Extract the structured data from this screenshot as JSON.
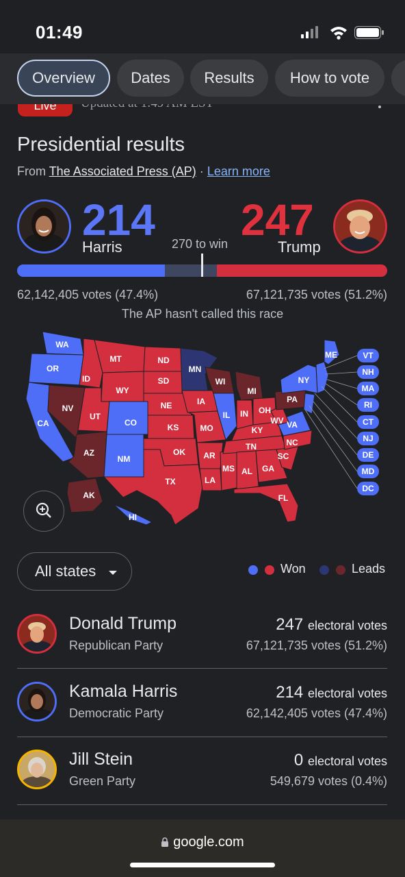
{
  "status": {
    "time": "01:49"
  },
  "tabs": [
    {
      "label": "Overview",
      "active": true
    },
    {
      "label": "Dates"
    },
    {
      "label": "Results"
    },
    {
      "label": "How to vote"
    }
  ],
  "live": {
    "badge": "Live",
    "updated": "Updated at 1:49 AM EST"
  },
  "header": {
    "title": "Presidential results",
    "source_prefix": "From",
    "source_name": "The Associated Press (AP)",
    "separator": "·",
    "learn_more": "Learn more"
  },
  "scoreboard": {
    "harris_ev": "214",
    "harris_name": "Harris",
    "trump_ev": "247",
    "trump_name": "Trump",
    "to_win": "270 to win",
    "harris_votes": "62,142,405 votes (47.4%)",
    "trump_votes": "67,121,735 votes (51.2%)",
    "harris_won_fraction": 0.4,
    "harris_lead_fraction": 0.14,
    "trump_fraction": 0.46,
    "called": "The AP hasn't called this race"
  },
  "colors": {
    "dem_won": "#4f6ef7",
    "dem_lead": "#2d3573",
    "rep_won": "#d32f3e",
    "rep_lead": "#6b262b",
    "background": "#202124"
  },
  "map": {
    "states": [
      "WA",
      "OR",
      "CA",
      "NV",
      "ID",
      "MT",
      "WY",
      "UT",
      "AZ",
      "CO",
      "NM",
      "ND",
      "SD",
      "NE",
      "KS",
      "OK",
      "TX",
      "MN",
      "IA",
      "MO",
      "AR",
      "LA",
      "WI",
      "IL",
      "MS",
      "MI",
      "IN",
      "KY",
      "TN",
      "AL",
      "OH",
      "GA",
      "FL",
      "SC",
      "NC",
      "VA",
      "WV",
      "PA",
      "NY",
      "ME",
      "AK",
      "HI"
    ],
    "callouts": [
      "VT",
      "NH",
      "MA",
      "RI",
      "CT",
      "NJ",
      "DE",
      "MD",
      "DC"
    ]
  },
  "filter": {
    "label": "All states"
  },
  "legend": {
    "won": "Won",
    "leads": "Leads"
  },
  "candidates": [
    {
      "name": "Donald Trump",
      "party": "Republican Party",
      "ev": "247",
      "ev_label": "electoral votes",
      "votes": "67,121,735 votes (51.2%)",
      "ring": "#d32f3e"
    },
    {
      "name": "Kamala Harris",
      "party": "Democratic Party",
      "ev": "214",
      "ev_label": "electoral votes",
      "votes": "62,142,405 votes (47.4%)",
      "ring": "#4f6ef7"
    },
    {
      "name": "Jill Stein",
      "party": "Green Party",
      "ev": "0",
      "ev_label": "electoral votes",
      "votes": "549,679 votes (0.4%)",
      "ring": "#f4b400"
    }
  ],
  "browser": {
    "url": "google.com"
  }
}
